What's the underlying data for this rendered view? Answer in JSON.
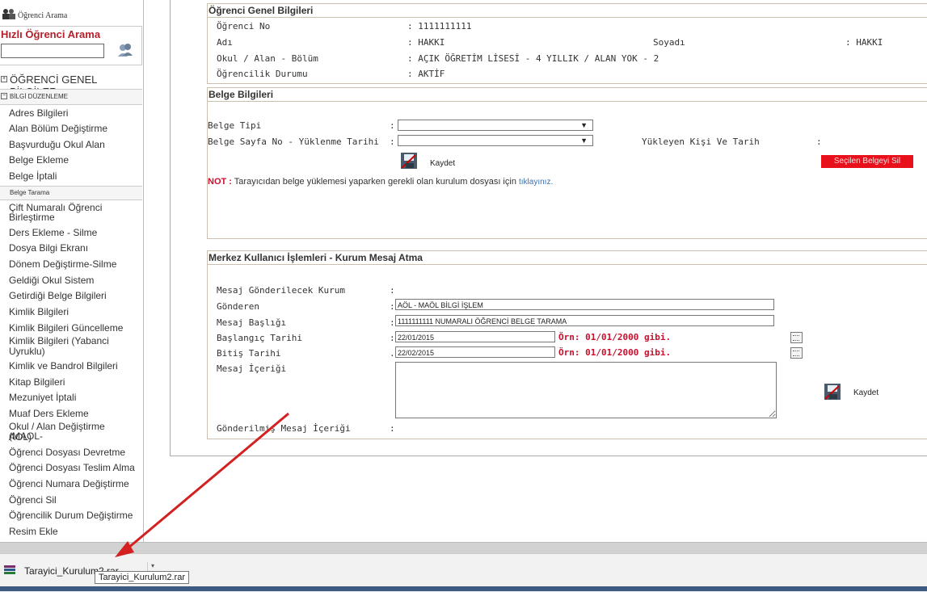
{
  "sidebar": {
    "header_label": "Öğrenci Arama",
    "quick_search_title": "Hızlı Öğrenci Arama",
    "quick_search_value": "",
    "section_genel": "ÖĞRENCİ GENEL BİLGİLER",
    "section_duzenleme": "BİLGİ DÜZENLEME",
    "items_a": [
      "Adres Bilgileri",
      "Alan Bölüm Değiştirme",
      "Başvurduğu Okul Alan",
      "Belge Ekleme",
      "Belge İptali"
    ],
    "sub_belge_tarama": "Belge Tarama",
    "items_b": [
      "Çift Numaralı Öğrenci",
      "Birleştirme",
      "Ders Ekleme - Silme",
      "Dosya Bilgi Ekranı",
      "Dönem Değiştirme-Silme",
      "Geldiği Okul Sistem",
      "Getirdiği Belge Bilgileri",
      "Kimlik Bilgileri",
      "Kimlik Bilgileri Güncelleme",
      "Kimlik Bilgileri (Yabanci",
      "Uyruklu)",
      "Kimlik ve Bandrol Bilgileri",
      "Kitap Bilgileri",
      "Mezuniyet İptali",
      "Muaf Ders Ekleme",
      "Okul / Alan Değiştirme (MAOL-",
      "AOL)",
      "Öğrenci Dosyası Devretme",
      "Öğrenci Dosyası Teslim Alma",
      "Öğrenci Numara Değiştirme",
      "Öğrenci Sil",
      "Öğrencilik Durum Değiştirme",
      "Resim Ekle"
    ]
  },
  "genel": {
    "title": "Öğrenci Genel Bilgileri",
    "ogrenci_no_label": "Öğrenci No",
    "ogrenci_no": ": 1111111111",
    "adi_label": "Adı",
    "adi": ": HAKKI",
    "soyadi_label": "Soyadı",
    "soyadi": ": HAKKI",
    "okul_label": "Okul / Alan - Bölüm",
    "okul": ": AÇIK ÖĞRETİM LİSESİ - 4 YILLIK / ALAN YOK - 2",
    "durum_label": "Öğrencilik Durumu",
    "durum": ": AKTİF"
  },
  "belge": {
    "title": "Belge Bilgileri",
    "tipi_label": "Belge Tipi",
    "sayfa_label": "Belge Sayfa No - Yüklenme Tarihi",
    "colon": ":",
    "yukleyen_label": "Yükleyen Kişi Ve Tarih",
    "kaydet": "Kaydet",
    "sil_button": "Seçilen Belgeyi Sil",
    "not_prefix": "NOT :",
    "not_text": " Tarayıcıdan belge yüklemesi yaparken gerekli olan kurulum dosyası için ",
    "not_link": "tıklayınız."
  },
  "mesaj": {
    "title": "Merkez Kullanıcı İşlemleri - Kurum Mesaj Atma",
    "kurum_label": "Mesaj Gönderilecek Kurum",
    "gonderen_label": "Gönderen",
    "gonderen": "AÖL - MAÖL BİLGİ İŞLEM",
    "baslik_label": "Mesaj Başlığı",
    "baslik": "1111111111 NUMARALI ÖĞRENCİ BELGE TARAMA",
    "baslangic_label": "Başlangıç Tarihi",
    "baslangic": "22/01/2015",
    "bitis_label": "Bitiş Tarihi",
    "bitis": "22/02/2015",
    "ornek": "Örn: 01/01/2000 gibi.",
    "icerik_label": "Mesaj İçeriği",
    "gonderilmis_label": "Gönderilmiş Mesaj İçeriği",
    "kaydet": "Kaydet",
    "colon": ":",
    "dot": "."
  },
  "download": {
    "filename": "Tarayici_Kurulum2.rar",
    "tooltip": "Tarayici_Kurulum2.rar"
  },
  "colors": {
    "accent_red": "#c8102e",
    "button_red": "#e8101b"
  }
}
